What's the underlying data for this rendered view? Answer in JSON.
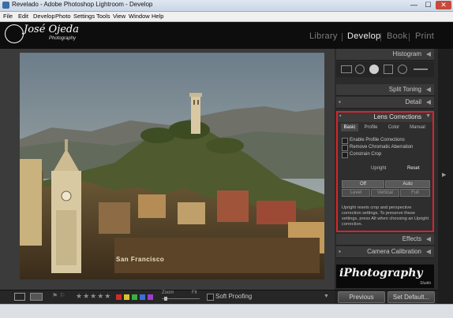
{
  "window": {
    "title": "Revelado - Adobe Photoshop Lightroom - Develop",
    "minimize": "—",
    "maximize": "☐",
    "close": "✕"
  },
  "menu": [
    "File",
    "Edit",
    "Develop",
    "Photo",
    "Settings",
    "Tools",
    "View",
    "Window",
    "Help"
  ],
  "identity": {
    "name": "José Ojeda",
    "sub": "Photography"
  },
  "modules": [
    "Library",
    "Develop",
    "Book",
    "Print"
  ],
  "active_module": "Develop",
  "panels": {
    "histogram": "Histogram",
    "split_toning": "Split Toning",
    "detail": "Detail",
    "lens_corrections": "Lens Corrections",
    "effects": "Effects",
    "camera_calibration": "Camera Calibration"
  },
  "lens": {
    "tabs": [
      "Basic",
      "Profile",
      "Color",
      "Manual"
    ],
    "selected_tab": "Basic",
    "options": [
      "Enable Profile Corrections",
      "Remove Chromatic Aberration",
      "Constrain Crop"
    ],
    "upright_label": "Upright",
    "reset": "Reset",
    "upright_buttons": [
      "Off",
      "Auto",
      "Level",
      "Vertical",
      "Full"
    ],
    "note": "Upright resets crop and perspective correction settings. To preserve these settings, press Alt when choosing an Upright correction."
  },
  "watermark": {
    "text": "iPhotography",
    "sub": "Studio"
  },
  "photo_watermark": "San Francisco",
  "toolbar": {
    "stars": "★★★★★",
    "zoom_label": "Zoom",
    "fit_label": "Fit",
    "soft_proofing": "Soft Proofing",
    "flags": "⚑ ⚐",
    "color_labels": [
      "#d12a2a",
      "#d8c42a",
      "#37b13b",
      "#3b6fd6",
      "#9b3fc6"
    ]
  },
  "buttons": {
    "previous": "Previous",
    "set_default": "Set Default..."
  }
}
